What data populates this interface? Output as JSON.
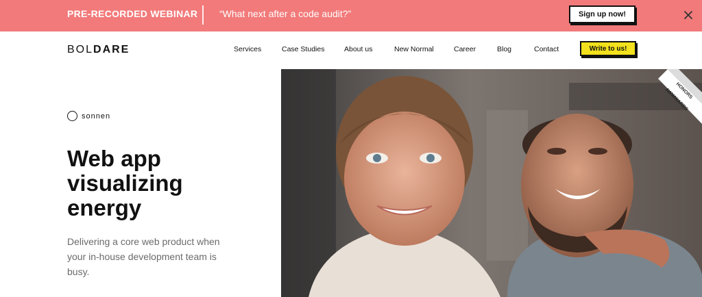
{
  "banner": {
    "kicker": "PRE-RECORDED WEBINAR",
    "quote": "“What next after a code audit?”",
    "cta": "Sign up now!"
  },
  "header": {
    "logo_light": "BOL",
    "logo_bold": "DARE",
    "nav": [
      "Services",
      "Case Studies",
      "About us",
      "New Normal",
      "Career",
      "Blog",
      "Contact"
    ],
    "cta": "Write to us!"
  },
  "hero": {
    "client": "sonnen",
    "title_lines": [
      "Web app",
      "visualizing",
      "energy"
    ],
    "description": "Delivering a core web product when your in-house development team is busy."
  },
  "awards": {
    "line1": "HONORS",
    "line2": "AWWWARDS"
  },
  "colors": {
    "banner": "#f27a7a",
    "cta_yellow": "#f2e11c",
    "text": "#111111"
  }
}
